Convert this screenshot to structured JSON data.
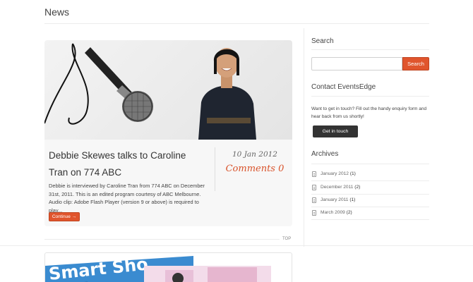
{
  "page": {
    "title": "News"
  },
  "post": {
    "title": "Debbie Skewes talks to Caroline Tran on 774 ABC",
    "date": "10 Jan 2012",
    "comments": "Comments 0",
    "excerpt": "Debbie is interviewed by Caroline Tran from 774 ABC on December 31st, 2011. This is an edited program courtesy of ABC Melbourne. Audio clip: Adobe Flash Player (version 9 or above) is required to play...",
    "continue_label": "Continue →",
    "top_label": "TOP"
  },
  "post2": {
    "image_text": "Smart Sho"
  },
  "sidebar": {
    "search": {
      "heading": "Search",
      "button_label": "Search",
      "value": ""
    },
    "contact": {
      "heading": "Contact EventsEdge",
      "text": "Want to get in touch? Fill out the handy enquiry form and hear back from us shortly!",
      "button_label": "Get in touch"
    },
    "archives": {
      "heading": "Archives",
      "items": [
        {
          "label": "January 2012",
          "count": "(1)"
        },
        {
          "label": "December 2011",
          "count": "(2)"
        },
        {
          "label": "January 2011",
          "count": "(1)"
        },
        {
          "label": "March 2009",
          "count": "(2)"
        }
      ]
    }
  },
  "colors": {
    "accent": "#e0552d",
    "dark_button": "#333333",
    "comments": "#d9532b"
  }
}
